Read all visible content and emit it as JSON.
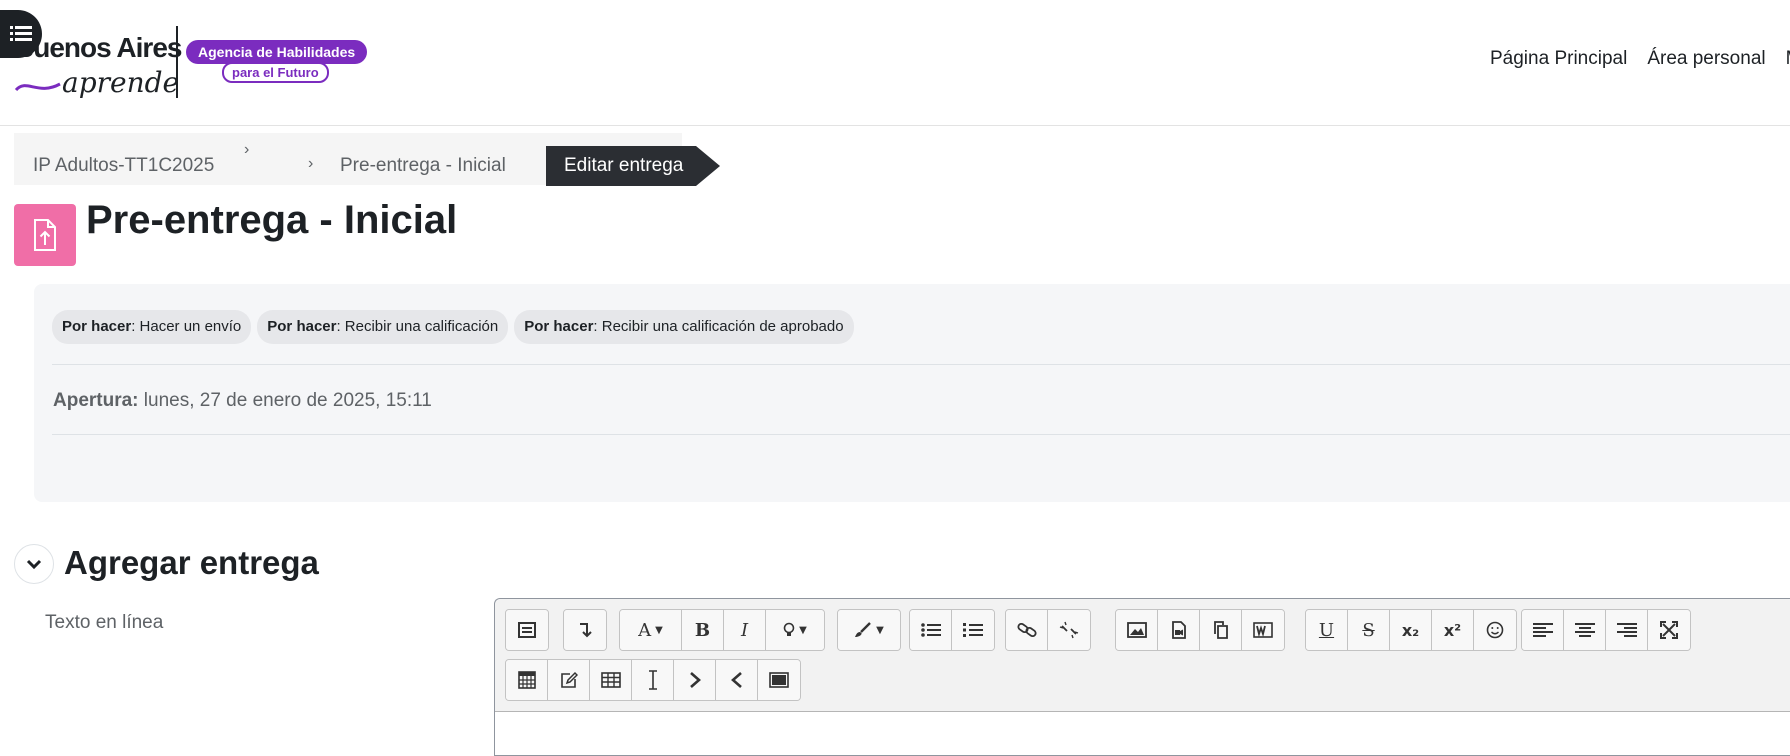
{
  "header": {
    "logo_ba": "Buenos Aires",
    "logo_aprende": "aprende",
    "agency_line1": "Agencia de Habilidades",
    "agency_line2": "para el Futuro",
    "nav": [
      "Página Principal",
      "Área personal",
      "M"
    ]
  },
  "breadcrumb": {
    "items": [
      "IP Adultos-TT1C2025",
      "Pre-entrega - Inicial"
    ],
    "separator": "›",
    "active": "Editar entrega"
  },
  "page": {
    "title": "Pre-entrega - Inicial",
    "icon": "assignment-upload-icon",
    "icon_color": "#f06ea7"
  },
  "activity": {
    "completion": [
      {
        "status": "Por hacer",
        "text": ": Hacer un envío"
      },
      {
        "status": "Por hacer",
        "text": ": Recibir una calificación"
      },
      {
        "status": "Por hacer",
        "text": ": Recibir una calificación de aprobado"
      }
    ],
    "opening_label": "Apertura:",
    "opening_value": " lunes, 27 de enero de 2025, 15:11"
  },
  "section": {
    "title": "Agregar entrega",
    "field_label": "Texto en línea"
  },
  "editor": {
    "row1": [
      [
        "toggle-toolbar-icon"
      ],
      [
        "arrow-down-icon"
      ],
      [
        "font-icon",
        "bold-icon",
        "italic-icon",
        "lightbulb-icon"
      ],
      [
        "brush-icon"
      ],
      [
        "bullet-list-icon",
        "numbered-list-icon"
      ],
      [
        "link-icon",
        "unlink-icon"
      ],
      [
        "image-icon",
        "media-icon",
        "copy-paste-icon",
        "word-paste-icon"
      ],
      [
        "underline-icon",
        "strikethrough-icon",
        "subscript-icon",
        "superscript-icon",
        "emoticon-icon"
      ],
      [
        "align-left-icon",
        "align-center-icon",
        "align-right-icon",
        "fullscreen-icon"
      ]
    ],
    "row2": [
      [
        "calculator-icon",
        "edit-note-icon",
        "table-icon",
        "text-cursor-icon",
        "indent-icon",
        "outdent-icon",
        "screen-reader-icon"
      ]
    ],
    "labels": {
      "font": "A",
      "bold": "B",
      "italic": "I",
      "underline": "U",
      "strike": "S",
      "sub": "x₂",
      "sup": "x²"
    }
  },
  "colors": {
    "brand_purple": "#7b2cbf",
    "dark": "#2b2e33",
    "activity_bg": "#f5f6f8"
  }
}
